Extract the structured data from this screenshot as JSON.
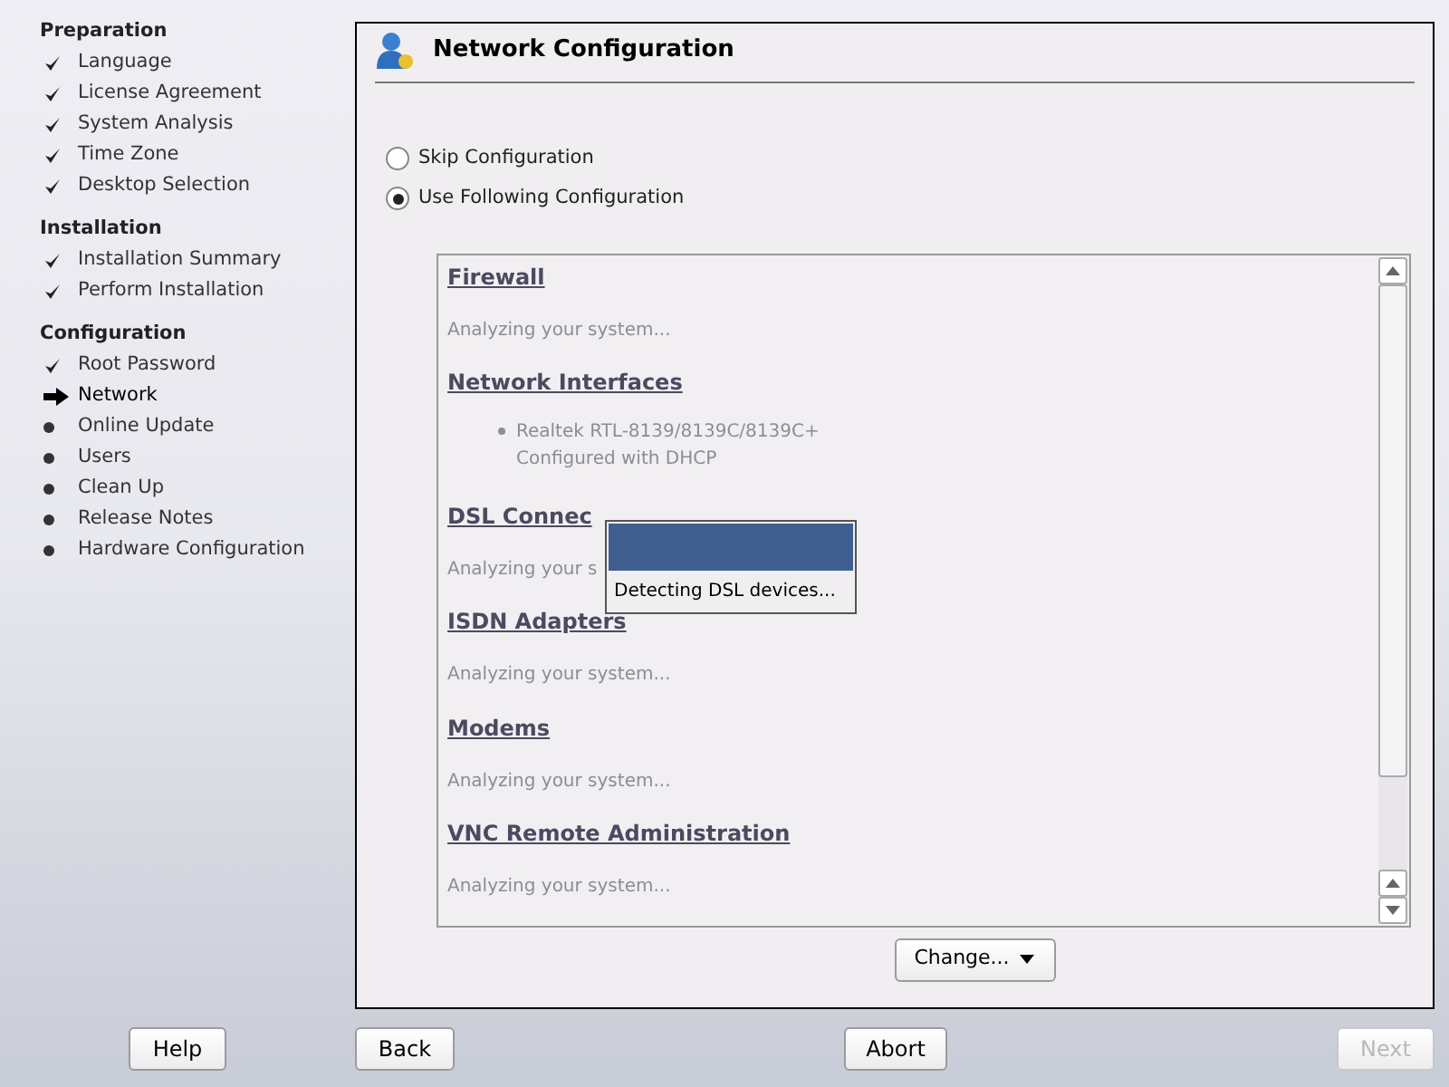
{
  "sidebar": [
    {
      "title": "Preparation",
      "items": [
        {
          "label": "Language",
          "kind": "done"
        },
        {
          "label": "License Agreement",
          "kind": "done"
        },
        {
          "label": "System Analysis",
          "kind": "done"
        },
        {
          "label": "Time Zone",
          "kind": "done"
        },
        {
          "label": "Desktop Selection",
          "kind": "done"
        }
      ]
    },
    {
      "title": "Installation",
      "items": [
        {
          "label": "Installation Summary",
          "kind": "done"
        },
        {
          "label": "Perform Installation",
          "kind": "done"
        }
      ]
    },
    {
      "title": "Configuration",
      "items": [
        {
          "label": "Root Password",
          "kind": "done"
        },
        {
          "label": "Network",
          "kind": "current"
        },
        {
          "label": "Online Update",
          "kind": "pending"
        },
        {
          "label": "Users",
          "kind": "pending"
        },
        {
          "label": "Clean Up",
          "kind": "pending"
        },
        {
          "label": "Release Notes",
          "kind": "pending"
        },
        {
          "label": "Hardware Configuration",
          "kind": "pending"
        }
      ]
    }
  ],
  "panel": {
    "title": "Network Configuration",
    "options": [
      {
        "label": "Skip Configuration",
        "selected": false
      },
      {
        "label": "Use Following Configuration",
        "selected": true
      }
    ],
    "sections": [
      {
        "heading": "Firewall",
        "kind": "text",
        "lines": [
          "Analyzing your system..."
        ]
      },
      {
        "heading": "Network Interfaces",
        "kind": "bullet",
        "lines": [
          "Realtek RTL-8139/8139C/8139C+",
          "Configured with DHCP"
        ]
      },
      {
        "heading": "DSL Connec",
        "kind": "text",
        "lines": [
          "Analyzing your s"
        ]
      },
      {
        "heading": "ISDN Adapters",
        "kind": "text",
        "lines": [
          "Analyzing your system..."
        ]
      },
      {
        "heading": "Modems",
        "kind": "text",
        "lines": [
          "Analyzing your system..."
        ]
      },
      {
        "heading": "VNC Remote Administration",
        "kind": "text",
        "lines": [
          "Analyzing your system..."
        ]
      }
    ],
    "popup": {
      "message": "Detecting DSL devices..."
    },
    "change_button": "Change..."
  },
  "buttons": [
    {
      "label": "Help",
      "disabled": false
    },
    {
      "label": "Back",
      "disabled": false
    },
    {
      "label": "Abort",
      "disabled": false
    },
    {
      "label": "Next",
      "disabled": true
    }
  ]
}
